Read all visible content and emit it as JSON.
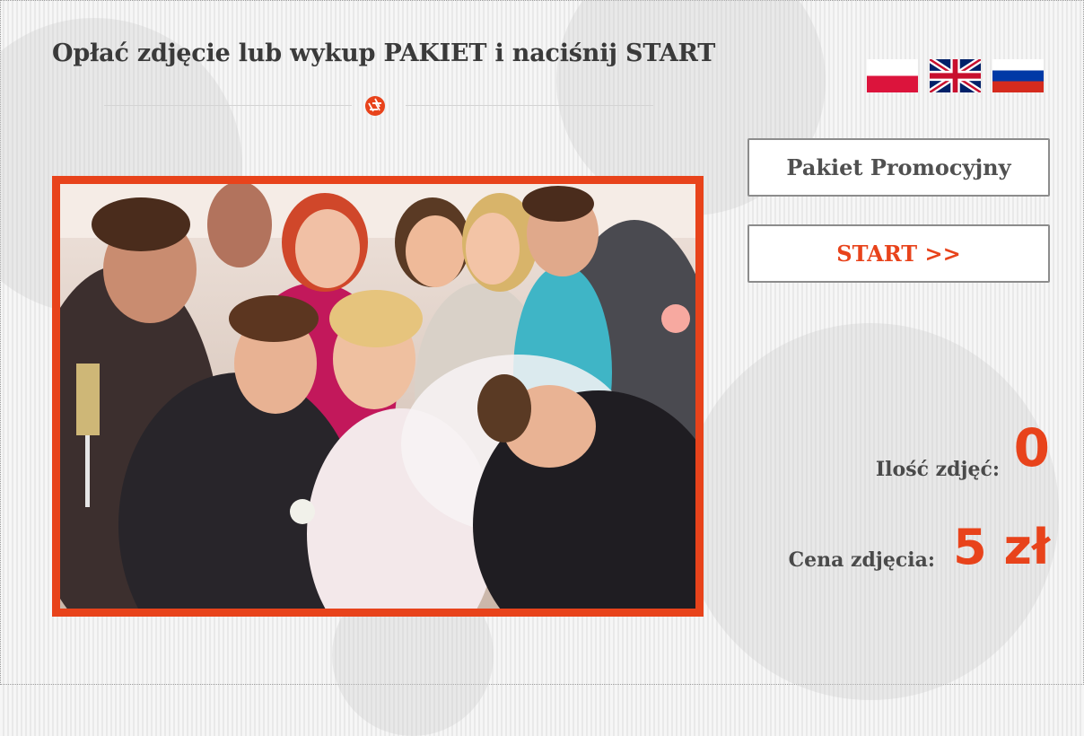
{
  "header": {
    "title": "Opłać zdjęcie lub wykup PAKIET i naciśnij START"
  },
  "languages": [
    {
      "code": "pl",
      "icon": "poland-flag-icon"
    },
    {
      "code": "en",
      "icon": "uk-flag-icon"
    },
    {
      "code": "ru",
      "icon": "russia-flag-icon"
    }
  ],
  "buttons": {
    "package_label": "Pakiet Promocyjny",
    "start_label": "START >>"
  },
  "stats": {
    "count_label": "Ilość zdjęć:",
    "count_value": "0",
    "price_label": "Cena zdjęcia:",
    "price_value": "5 zł"
  },
  "colors": {
    "accent": "#e8431b",
    "text": "#3a3a3a",
    "button_border": "#8c8c8c"
  },
  "icons": {
    "logo": "camera-aperture-icon",
    "photo": "party-photo-image"
  }
}
